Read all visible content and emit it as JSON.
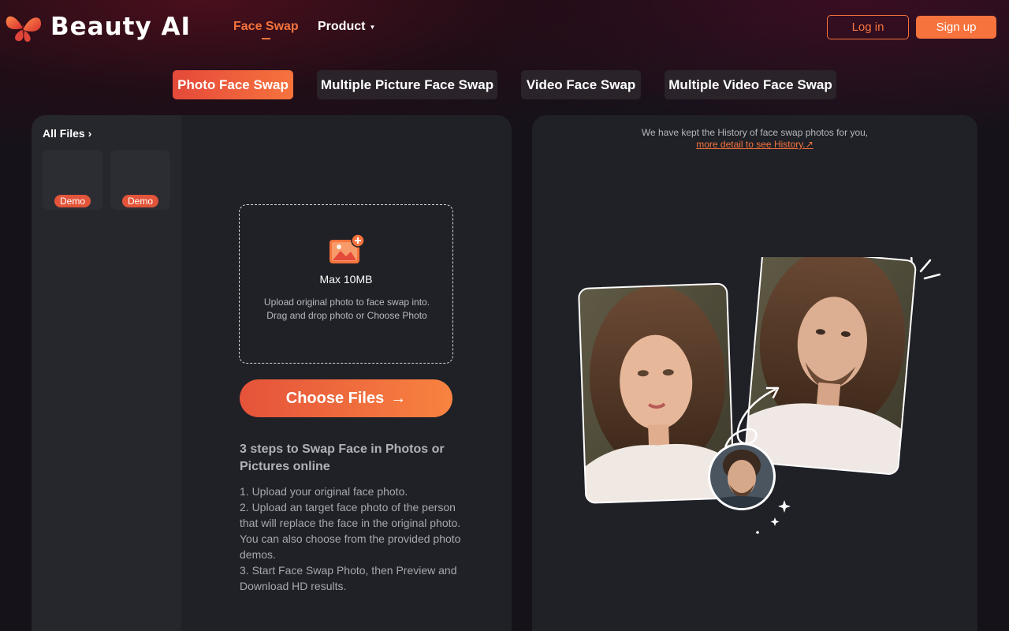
{
  "header": {
    "brand": "Beauty AI",
    "nav": {
      "face_swap": "Face Swap",
      "product": "Product"
    },
    "login": "Log in",
    "signup": "Sign up"
  },
  "tabs": [
    {
      "label": "Photo Face Swap",
      "active": true
    },
    {
      "label": "Multiple Picture Face Swap",
      "active": false
    },
    {
      "label": "Video Face Swap",
      "active": false
    },
    {
      "label": "Multiple Video Face Swap",
      "active": false
    }
  ],
  "files": {
    "all_files_label": "All Files",
    "thumbnails": [
      {
        "badge": "Demo"
      },
      {
        "badge": "Demo"
      }
    ]
  },
  "upload": {
    "max_size": "Max 10MB",
    "hint": "Upload original photo to face swap into. Drag and drop photo or Choose Photo",
    "button": "Choose Files"
  },
  "steps": {
    "title": "3 steps to Swap Face in Photos or Pictures online",
    "items": [
      "1. Upload your original face photo.",
      "2. Upload an target face photo of the person that will replace the face in the original photo. You can also choose from the provided photo demos.",
      "3. Start Face Swap Photo, then Preview and Download HD results."
    ]
  },
  "history": {
    "text": "We have kept the History of face swap photos for you,",
    "link": "more detail to see History.↗"
  },
  "colors": {
    "accent": "#f6733d",
    "accent_red": "#e5493a",
    "panel": "#202127",
    "background": "#15121a"
  }
}
